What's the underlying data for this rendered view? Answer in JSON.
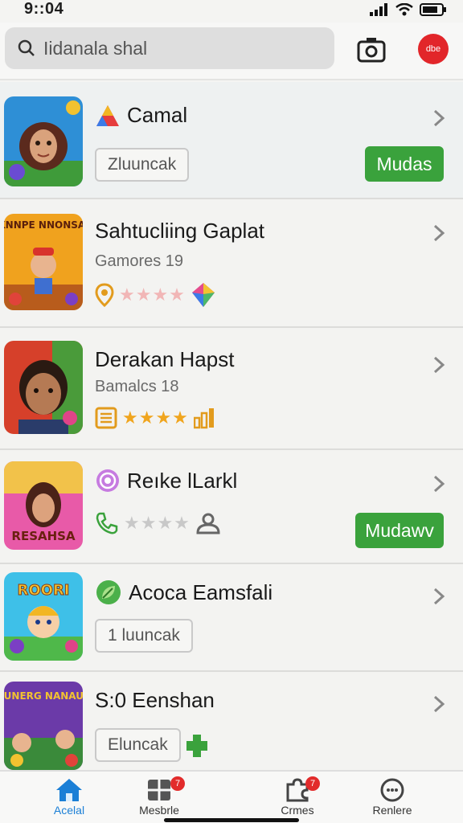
{
  "status": {
    "time": "9::04"
  },
  "search": {
    "placeholder": "Iidanala shal",
    "icon": "search-icon"
  },
  "header": {
    "avatar_text": "dbe"
  },
  "items": [
    {
      "title": "Camal",
      "button": "Zluuncak",
      "action": "Mudas"
    },
    {
      "title": "Sahtucliing Gaplat",
      "subtitle": "Gamores 19",
      "thumb_text": "KNNPE NNONSAI"
    },
    {
      "title": "Derakan Hapst",
      "subtitle": "Bamalcs 18"
    },
    {
      "title": "Reıke lLarkl",
      "action": "Mudawv",
      "thumb_text": "RESAHSA"
    },
    {
      "title": "Acoca Eamsfali",
      "button": "1 luuncak",
      "thumb_text": "ROORI"
    },
    {
      "title": "S:0 Eenshan",
      "button": "Eluncak",
      "thumb_text": "RUNERG NANAUS"
    }
  ],
  "nav": [
    {
      "label": "Acelal",
      "active": true
    },
    {
      "label": "Mesbrle",
      "badge": "7"
    },
    {
      "label": "Crmes",
      "badge": "7"
    },
    {
      "label": "Renlere"
    }
  ],
  "colors": {
    "accent_green": "#3aa23c",
    "active_blue": "#1b7fd6",
    "badge_red": "#e22b2b"
  }
}
